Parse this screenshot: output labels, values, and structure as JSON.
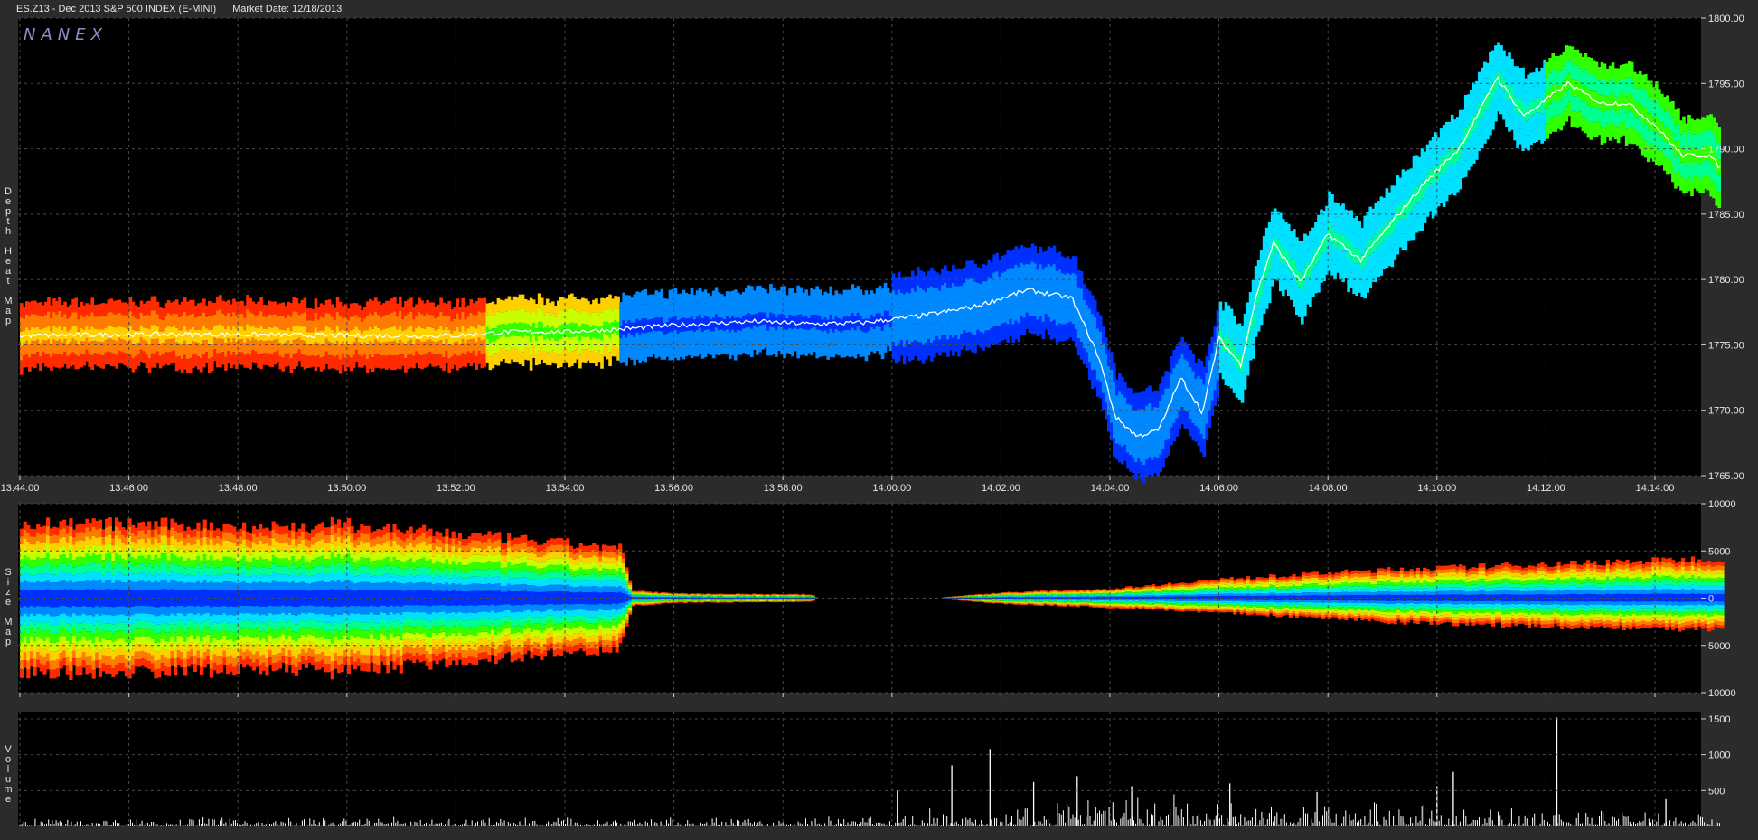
{
  "header": {
    "symbol_desc": "ES.Z13 - Dec 2013 S&P 500 INDEX (E-MINI)",
    "market_date": "Market Date: 12/18/2013"
  },
  "brand": "NANEX",
  "panels": {
    "depth": {
      "label": "Depth Heat Map"
    },
    "size": {
      "label": "Size Map"
    },
    "volume": {
      "label": "Volume"
    }
  },
  "colors": {
    "background": "#000000",
    "frame": "#2b2b2b",
    "grid": "#4a4a4a",
    "price_line": "#ffffff",
    "heat_scale": [
      "#ff2a00",
      "#ff7a00",
      "#ffd000",
      "#c8ff00",
      "#30ff00",
      "#00ff90",
      "#00e0ff",
      "#0088ff",
      "#0030ff"
    ]
  },
  "chart_data": [
    {
      "type": "heatmap",
      "title": "Depth Heat Map",
      "x_axis": {
        "ticks": [
          "13:44:00",
          "13:46:00",
          "13:48:00",
          "13:50:00",
          "13:52:00",
          "13:54:00",
          "13:56:00",
          "13:58:00",
          "14:00:00",
          "14:02:00",
          "14:04:00",
          "14:06:00",
          "14:08:00",
          "14:10:00",
          "14:12:00",
          "14:14:00"
        ]
      },
      "y_axis": {
        "ticks": [
          "1800.00",
          "1795.00",
          "1790.00",
          "1785.00",
          "1780.00",
          "1775.00",
          "1770.00",
          "1765.00"
        ],
        "ylim": [
          1765,
          1800
        ]
      },
      "x_minutes_range": [
        0,
        31.2
      ],
      "price_series": {
        "x_minutes": [
          0,
          2,
          4,
          6,
          8,
          9,
          10,
          11,
          12,
          13.5,
          14.5,
          15.5,
          16.5,
          17.5,
          18.5,
          19,
          19.3,
          19.8,
          20.1,
          20.5,
          20.9,
          21.3,
          21.7,
          22,
          22.4,
          22.7,
          23,
          23.5,
          24,
          24.6,
          25.2,
          25.8,
          26.4,
          26.8,
          27.1,
          27.6,
          28.4,
          29,
          29.5,
          30,
          30.5,
          31,
          31.2
        ],
        "y_price": [
          1775.7,
          1775.8,
          1775.8,
          1775.7,
          1775.7,
          1776.0,
          1776.0,
          1776.2,
          1776.5,
          1776.8,
          1776.6,
          1776.7,
          1777.2,
          1777.9,
          1779.2,
          1778.8,
          1778.6,
          1774.0,
          1769.5,
          1768.0,
          1768.5,
          1772.5,
          1769.8,
          1775.5,
          1773.5,
          1779.0,
          1782.8,
          1779.8,
          1783.5,
          1781.5,
          1784.5,
          1787.5,
          1790.0,
          1793.0,
          1795.5,
          1792.5,
          1795.0,
          1793.5,
          1793.5,
          1791.8,
          1789.5,
          1789.5,
          1788.5
        ]
      },
      "band_color_by_minute": [
        {
          "from": 0,
          "to": 8.5,
          "color": "orange-yellow"
        },
        {
          "from": 8.5,
          "to": 11,
          "color": "yellow-green"
        },
        {
          "from": 11,
          "to": 16,
          "color": "blue"
        },
        {
          "from": 16,
          "to": 22,
          "color": "deep blue"
        },
        {
          "from": 22,
          "to": 28,
          "color": "cyan"
        },
        {
          "from": 28,
          "to": 31.2,
          "color": "green"
        }
      ]
    },
    {
      "type": "heatmap",
      "title": "Size Map",
      "y_axis": {
        "ticks": [
          "10000",
          "5000",
          "0",
          "5000",
          "10000"
        ],
        "ylim": [
          -10000,
          10000
        ]
      },
      "amplitude_by_minute": {
        "x_minutes": [
          0,
          5.5,
          5.6,
          11,
          11.2,
          12,
          14.5,
          14.6,
          16.8,
          17,
          18,
          20,
          22,
          25,
          28,
          31.2
        ],
        "bid": [
          8000,
          7500,
          7900,
          5300,
          800,
          500,
          400,
          0,
          0,
          150,
          600,
          1000,
          2000,
          3000,
          3600,
          4200
        ],
        "ask": [
          8000,
          7500,
          7900,
          5300,
          800,
          500,
          400,
          0,
          0,
          150,
          600,
          1000,
          1500,
          2500,
          3000,
          3300
        ]
      }
    },
    {
      "type": "bar",
      "title": "Volume",
      "y_axis": {
        "ticks": [
          "1500",
          "1000",
          "500"
        ],
        "ylim": [
          0,
          1600
        ]
      },
      "volume_regime_by_minute": {
        "x_minutes": [
          0,
          16,
          16.1,
          20,
          24,
          28,
          31.2
        ],
        "typical": [
          80,
          80,
          150,
          300,
          220,
          170,
          150
        ]
      },
      "notable_spikes": [
        {
          "x_minute": 16.1,
          "value": 500
        },
        {
          "x_minute": 17.1,
          "value": 850
        },
        {
          "x_minute": 17.8,
          "value": 1080
        },
        {
          "x_minute": 18.6,
          "value": 620
        },
        {
          "x_minute": 19.4,
          "value": 700
        },
        {
          "x_minute": 20.4,
          "value": 560
        },
        {
          "x_minute": 22.2,
          "value": 600
        },
        {
          "x_minute": 23.8,
          "value": 480
        },
        {
          "x_minute": 26.0,
          "value": 560
        },
        {
          "x_minute": 26.3,
          "value": 760
        },
        {
          "x_minute": 28.2,
          "value": 1520
        },
        {
          "x_minute": 30.2,
          "value": 380
        }
      ]
    }
  ]
}
